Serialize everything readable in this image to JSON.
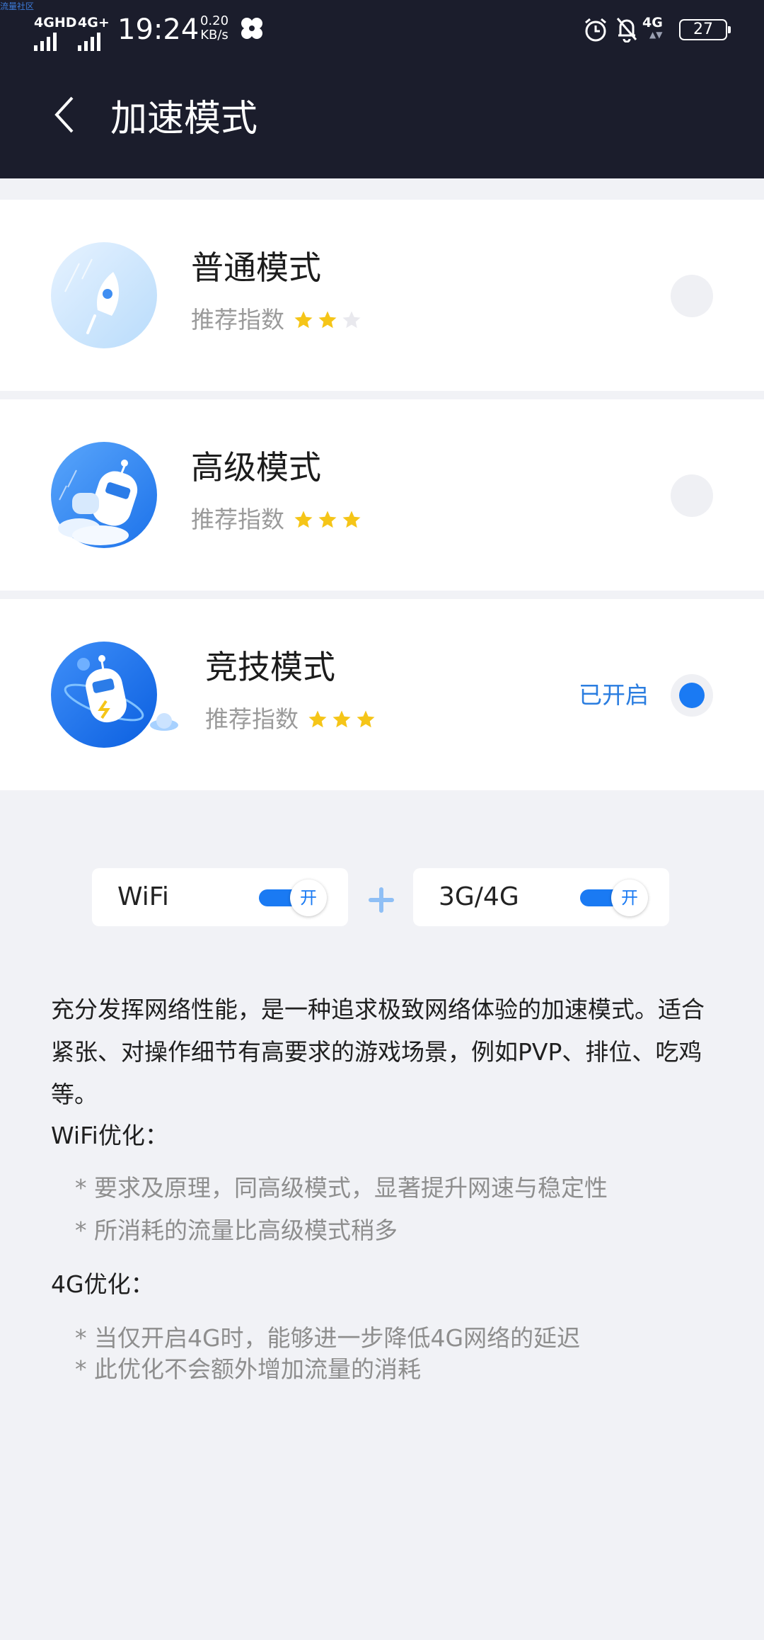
{
  "watermark": "流量社区",
  "status": {
    "net1": "4GHD",
    "net2": "4G+",
    "time": "19:24",
    "speed_value": "0.20",
    "speed_unit": "KB/s",
    "net3": "4G",
    "battery": "27"
  },
  "header": {
    "title": "加速模式"
  },
  "modes": [
    {
      "name": "普通模式",
      "rec_label": "推荐指数",
      "rating": 2,
      "max_rating": 3,
      "selected": false
    },
    {
      "name": "高级模式",
      "rec_label": "推荐指数",
      "rating": 3,
      "max_rating": 3,
      "selected": false
    },
    {
      "name": "竞技模式",
      "rec_label": "推荐指数",
      "rating": 3,
      "max_rating": 3,
      "selected": true,
      "status": "已开启"
    }
  ],
  "networks": [
    {
      "label": "WiFi",
      "toggle_text": "开",
      "on": true
    },
    {
      "label": "3G/4G",
      "toggle_text": "开",
      "on": true
    }
  ],
  "description": {
    "main": "充分发挥网络性能，是一种追求极致网络体验的加速模式。适合紧张、对操作细节有高要求的游戏场景，例如PVP、排位、吃鸡等。",
    "wifi_heading": "WiFi优化：",
    "wifi_items": [
      "* 要求及原理，同高级模式，显著提升网速与稳定性",
      "* 所消耗的流量比高级模式稍多"
    ],
    "g4_heading": "4G优化：",
    "g4_items": [
      "* 当仅开启4G时，能够进一步降低4G网络的延迟",
      "* 此优化不会额外增加流量的消耗"
    ]
  },
  "colors": {
    "header_bg": "#1b1d2c",
    "accent": "#1a7af3",
    "star": "#f5c518",
    "star_empty": "#e9e9ee",
    "page_bg": "#f1f2f6"
  }
}
